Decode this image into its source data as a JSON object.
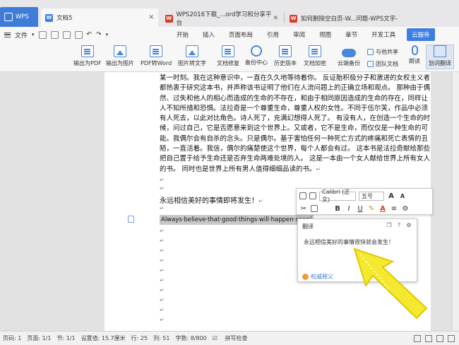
{
  "tabs": {
    "wps_label": "WPS",
    "doc_label": "文档5",
    "web1_label": "WPS2016下载_...ord学习和分享平台",
    "web2_label": "如何删除空白页-W...问题-WPS文字-"
  },
  "menu": {
    "file_label": "文件",
    "items": [
      "开始",
      "插入",
      "页面布局",
      "引用",
      "审阅",
      "视图",
      "章节",
      "开发工具"
    ],
    "cloud_label": "云服务"
  },
  "ribbon": {
    "export_pdf": "输出为PDF",
    "export_pic": "输出为图片",
    "pdf_to_word": "PDF转Word",
    "pic_to_text": "图片转文字",
    "doc_repair": "文档修复",
    "backup_center": "备份中心",
    "history": "历史版本",
    "encrypt": "文档加密",
    "cloud_backup": "云端备份",
    "share": "与他共享",
    "team_doc": "团队文档",
    "read_aloud": "朗读",
    "mark_translate": "划词翻译"
  },
  "document": {
    "paragraph": "某一时刻。我在这种意识中，一直在久久地等待着你。 反证胎积极分子和激进的女权主义者都热衷于研究这本书，并声称该书证明了他们在人流问题上的正确立场和观点。 那种由于偶然、过失和他人的相心而造成的生命的不存在，和由于相同原因造成的生命的存在，同样让人不知所措和恐惧。法拉奇是一个尊重生命，尊重人权的女性。不同于伍尔芙，作品中必须有人死去，以此对比角色。诗人死了，充满幻想得人死了。 有没有人，在创造一个生命的时候，问过自己，它是否愿意来到这个世界上。又或者，它不是生命，而仅仅是一种生命的可能。我偶尔会有自杀的念头。只是偶尔。基于害怕任何一种死亡方式的疼痛和死亡表情的丑陋，一直活着。我信，偶尔的痛楚使这个世界，每个人都会有过。 这本书是法拉奇献给那些把自己置于给予生命还是否弃生命两难处境的人。 这是一本由一个女人献给世界上所有女人的书。 同时也是世界上所有男人值得细细品读的书。",
    "wish_line": "永远相信美好的事情即将发生！",
    "english_line": "Always·believe·that·good·things·will·happen·soon!"
  },
  "float_toolbar": {
    "font_name": "Calibri (正文)",
    "font_size": "五号"
  },
  "translate_panel": {
    "title": "翻译",
    "result": "永远相信美好的事情很快就会发生！",
    "link": "权威释义"
  },
  "status": {
    "page": "页码: 1",
    "pages": "页面: 1/1",
    "section": "节: 1/1",
    "position": "设置值: 15.7厘米",
    "row": "行: 25",
    "col": "列: 51",
    "words": "字数: 8/800",
    "spellcheck": "拼写检查"
  }
}
